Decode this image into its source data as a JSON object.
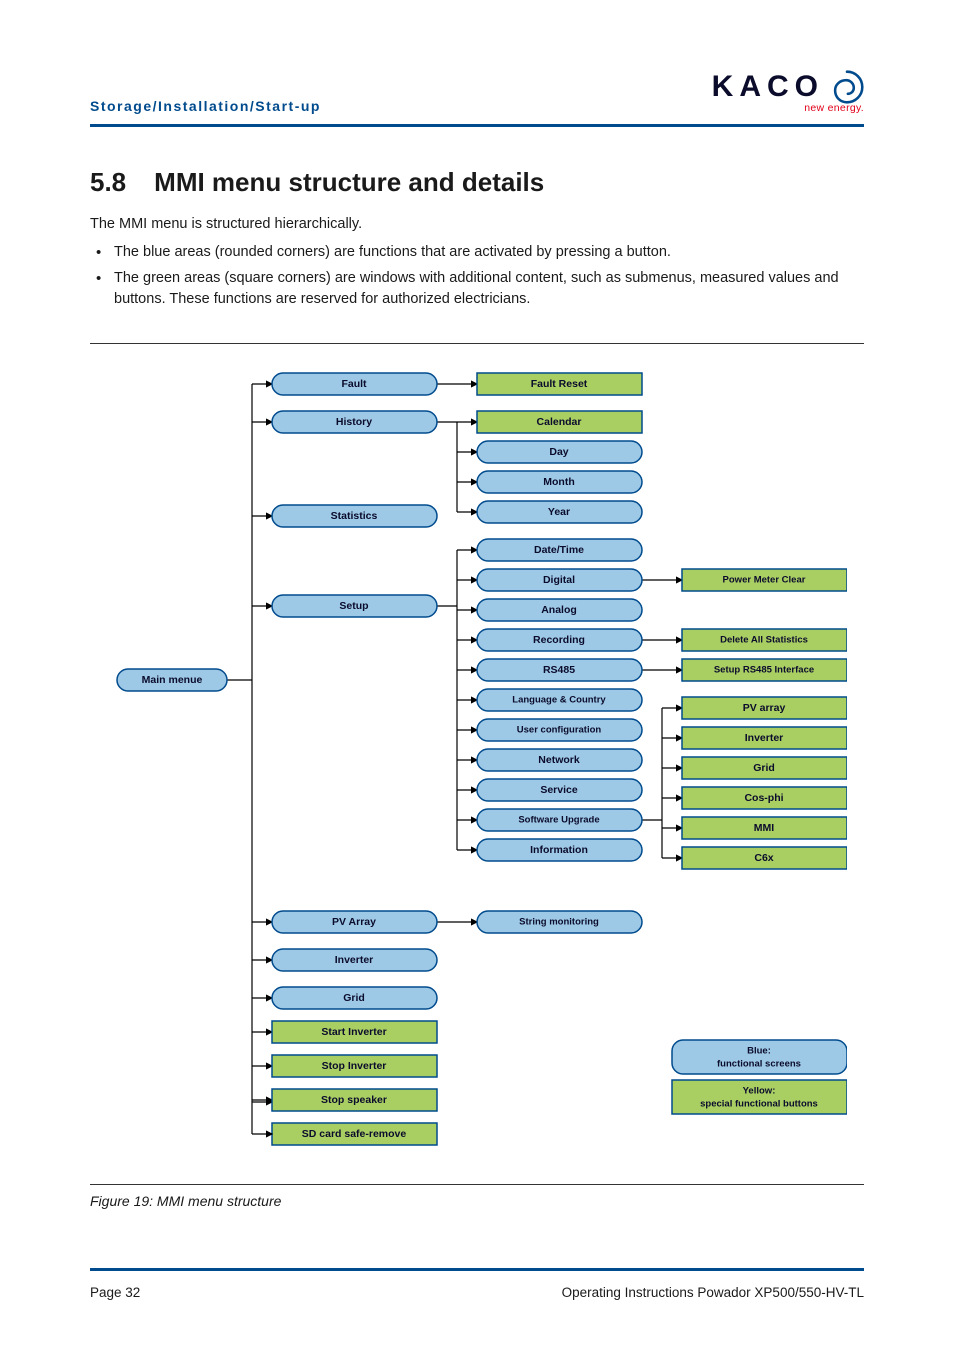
{
  "header": {
    "breadcrumb": "Storage/Installation/Start-up",
    "logo_text": "KACO",
    "logo_tag": "new energy."
  },
  "section": {
    "number": "5.8",
    "title": "MMI menu structure and details",
    "intro": "The MMI menu is structured hierarchically.",
    "bullets": [
      "The blue areas (rounded corners) are functions that are activated by pressing a button.",
      "The green areas (square corners) are windows with additional content, such as submenus, measured values and buttons. These functions are reserved for authorized electricians."
    ]
  },
  "diagram": {
    "root": "Main menue",
    "col1": {
      "fault": "Fault",
      "history": "History",
      "statistics": "Statistics",
      "setup": "Setup",
      "pv_array": "PV Array",
      "inverter": "Inverter",
      "grid": "Grid",
      "start_inverter": "Start Inverter",
      "stop_inverter": "Stop Inverter",
      "stop_speaker": "Stop speaker",
      "sd_safe_remove": "SD card safe-remove"
    },
    "col2": {
      "fault_reset": "Fault Reset",
      "calendar": "Calendar",
      "day": "Day",
      "month": "Month",
      "year": "Year",
      "date_time": "Date/Time",
      "digital": "Digital",
      "analog": "Analog",
      "recording": "Recording",
      "rs485": "RS485",
      "lang_country": "Language & Country",
      "user_config": "User configuration",
      "network": "Network",
      "service": "Service",
      "sw_upgrade": "Software Upgrade",
      "information": "Information",
      "string_monitoring": "String monitoring"
    },
    "col3": {
      "power_meter_clear": "Power Meter Clear",
      "delete_all_stats": "Delete All Statistics",
      "setup_rs485": "Setup RS485 Interface",
      "pv_array": "PV array",
      "inverter": "Inverter",
      "grid": "Grid",
      "cos_phi": "Cos-phi",
      "mmi": "MMI",
      "c6x": "C6x"
    },
    "legend": {
      "blue_l1": "Blue:",
      "blue_l2": "functional screens",
      "yellow_l1": "Yellow:",
      "yellow_l2": "special functional buttons"
    }
  },
  "figure_caption": "Figure 19:  MMI menu structure",
  "footer": {
    "page": "Page 32",
    "doc": "Operating Instructions Powador XP500/550-HV-TL"
  }
}
